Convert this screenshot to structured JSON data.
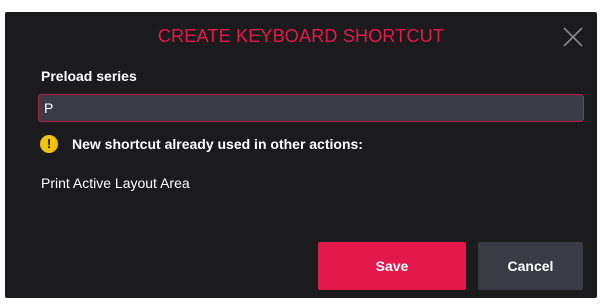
{
  "dialog": {
    "title": "CREATE KEYBOARD SHORTCUT",
    "close_icon": "close-icon",
    "field_label": "Preload series",
    "shortcut_value": "P",
    "warning_icon": "warning-icon",
    "warning_text": "New shortcut already used in other actions:",
    "conflicting_actions": [
      "Print Active Layout Area"
    ],
    "save_label": "Save",
    "cancel_label": "Cancel"
  },
  "colors": {
    "accent": "#e4194b",
    "background": "#1b1b1d",
    "input_bg": "#3a3b45",
    "warning": "#f0c20a"
  }
}
